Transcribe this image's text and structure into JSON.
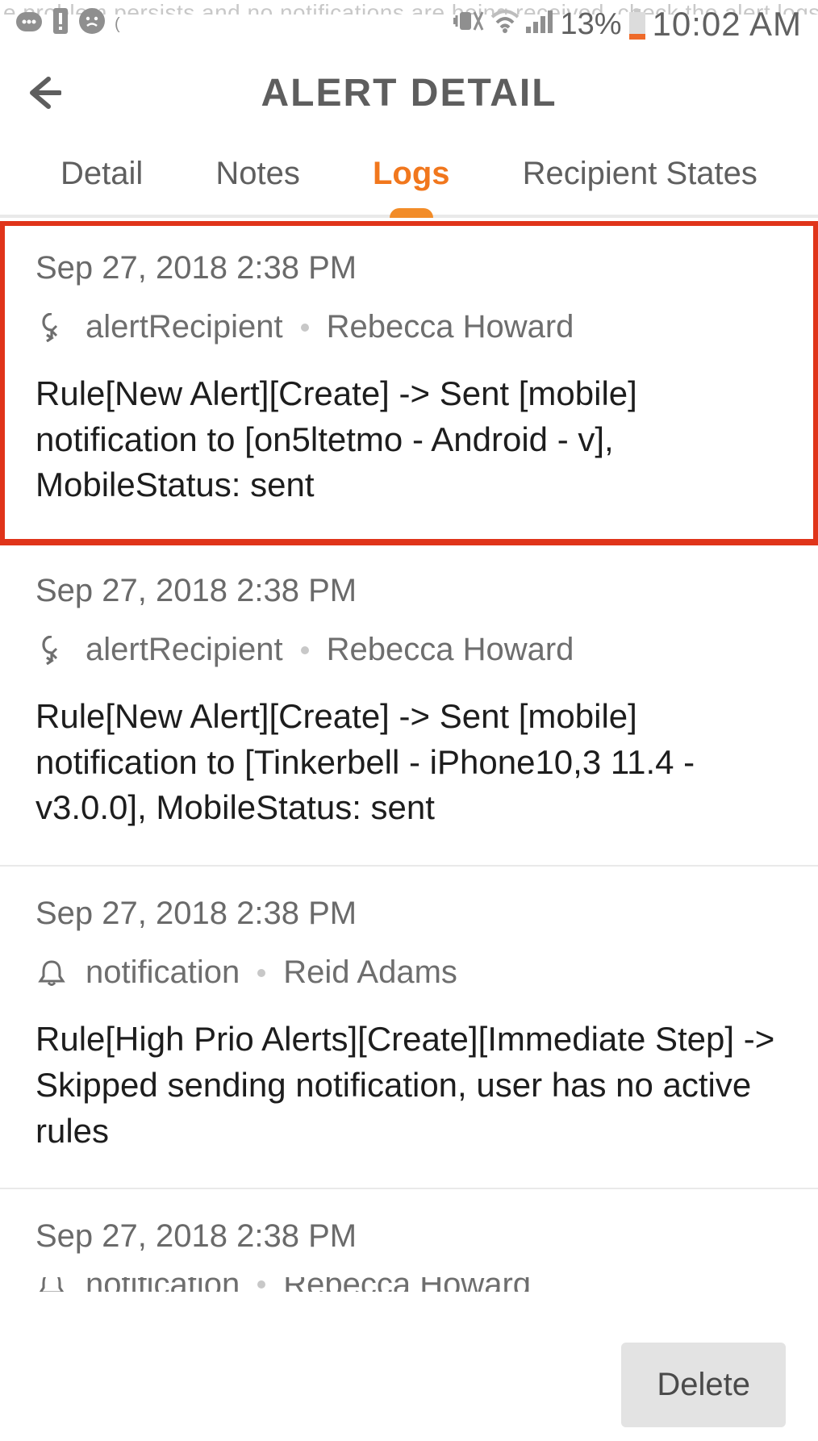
{
  "background_truncated_text": "e problem persists and no notifications are being received, check the alert logs. T",
  "status": {
    "battery_percent": "13%",
    "time": "10:02 AM"
  },
  "header": {
    "title": "ALERT DETAIL"
  },
  "tabs": {
    "items": [
      {
        "label": "Detail",
        "active": false
      },
      {
        "label": "Notes",
        "active": false
      },
      {
        "label": "Logs",
        "active": true
      },
      {
        "label": "Recipient States",
        "active": false
      }
    ]
  },
  "logs": [
    {
      "timestamp": "Sep 27, 2018 2:38 PM",
      "type_icon": "recipient",
      "type_label": "alertRecipient",
      "actor": "Rebecca Howard",
      "message": "Rule[New Alert][Create] -> Sent [mobile] notification to [on5ltetmo - Android  - v], MobileStatus: sent",
      "highlighted": true
    },
    {
      "timestamp": "Sep 27, 2018 2:38 PM",
      "type_icon": "recipient",
      "type_label": "alertRecipient",
      "actor": "Rebecca Howard",
      "message": "Rule[New Alert][Create] -> Sent [mobile] notification to [Tinkerbell - iPhone10,3 11.4 - v3.0.0], MobileStatus: sent",
      "highlighted": false
    },
    {
      "timestamp": "Sep 27, 2018 2:38 PM",
      "type_icon": "bell",
      "type_label": "notification",
      "actor": "Reid Adams",
      "message": "Rule[High Prio Alerts][Create][Immediate Step] -> Skipped sending notification, user has no active rules",
      "highlighted": false
    },
    {
      "timestamp": "Sep 27, 2018 2:38 PM",
      "type_icon": "bell",
      "type_label": "notification",
      "actor": "Rebecca Howard",
      "message": "",
      "highlighted": false
    }
  ],
  "footer": {
    "delete_label": "Delete"
  }
}
